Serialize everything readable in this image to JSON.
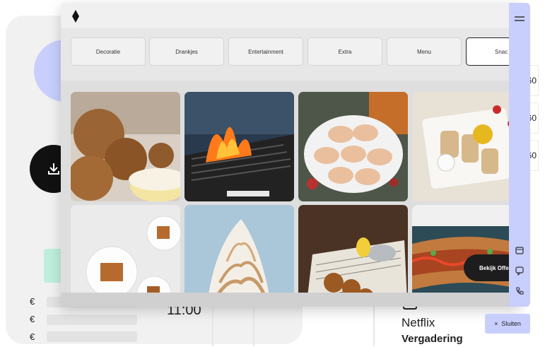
{
  "categories": {
    "tabs": [
      "Decoratie",
      "Drankjes",
      "Entertainment",
      "Extra",
      "Menu",
      "Snac"
    ],
    "active": "Snac"
  },
  "gallery": {
    "tiles": [
      "bitterballen",
      "grill-fire",
      "macarons",
      "bread-dip",
      "pastry-plates",
      "meringue",
      "fish-and-chips",
      "hotdog"
    ]
  },
  "offer_button": "Bekijk Offe",
  "close_button": {
    "label": "Sluiten",
    "icon": "×"
  },
  "background": {
    "time": "11:00",
    "event_title": "Netflix",
    "event_subtitle": "Vergadering",
    "currency_symbol": "€",
    "numbers": [
      "60",
      "60",
      "60"
    ]
  },
  "colors": {
    "accent": "#c8cffd",
    "dark": "#1d1d1d",
    "mint": "#bfeedd"
  }
}
